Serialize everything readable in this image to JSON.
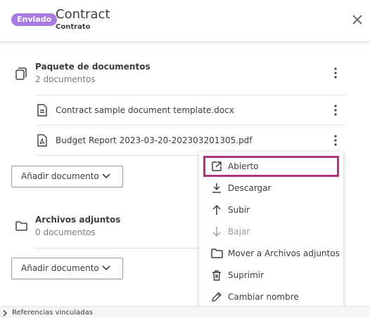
{
  "header": {
    "status_badge": "Enviado",
    "title": "Contract",
    "subtitle": "Contrato",
    "close_icon": "close-icon"
  },
  "package": {
    "title": "Paquete de documentos",
    "count": "2 documentos",
    "files": [
      {
        "name": "Contract sample document template.docx",
        "icon": "document-icon"
      },
      {
        "name": "Budget Report 2023-03-20-202303201305.pdf",
        "icon": "pdf-icon"
      }
    ],
    "add_label": "Añadir documento"
  },
  "attachments": {
    "title": "Archivos adjuntos",
    "count": "0 documentos",
    "add_label": "Añadir documento"
  },
  "context_menu": {
    "items": [
      {
        "label": "Abierto",
        "icon": "open-external-icon",
        "enabled": true,
        "highlighted": true
      },
      {
        "label": "Descargar",
        "icon": "download-icon",
        "enabled": true
      },
      {
        "label": "Subir",
        "icon": "arrow-up-icon",
        "enabled": true
      },
      {
        "label": "Bajar",
        "icon": "arrow-down-icon",
        "enabled": false
      },
      {
        "label": "Mover a Archivos adjuntos",
        "icon": "folder-icon",
        "enabled": true
      },
      {
        "label": "Suprimir",
        "icon": "trash-icon",
        "enabled": true
      },
      {
        "label": "Cambiar nombre",
        "icon": "pencil-icon",
        "enabled": true
      }
    ]
  },
  "footer": {
    "label": "Referencias vinculadas"
  },
  "colors": {
    "badge": "#a77be0",
    "highlight_border": "#b0307a",
    "text": "#3c3c3c",
    "muted": "#7a7a7a"
  }
}
